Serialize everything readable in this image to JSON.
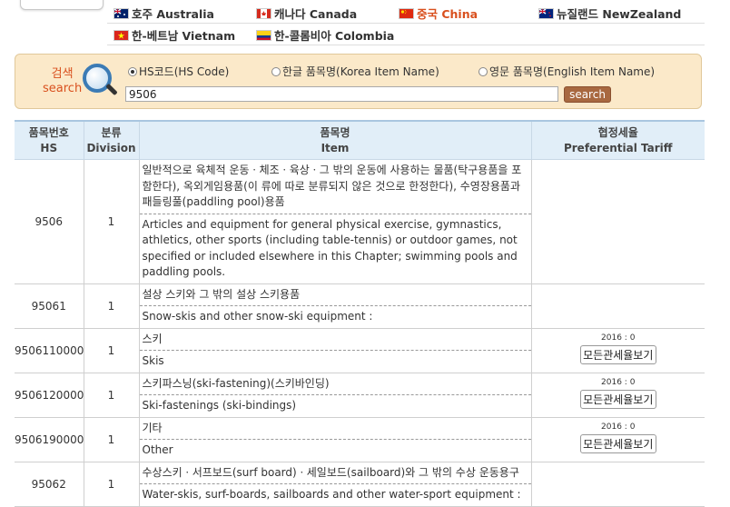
{
  "countries": {
    "row1": [
      {
        "label": "호주 Australia",
        "flag": "australia-flag-icon"
      },
      {
        "label": "캐나다 Canada",
        "flag": "canada-flag-icon"
      },
      {
        "label": "중국 China",
        "flag": "china-flag-icon",
        "active": true
      },
      {
        "label": "뉴질랜드 NewZealand",
        "flag": "newzealand-flag-icon"
      }
    ],
    "row2": [
      {
        "label": "한-베트남 Vietnam",
        "flag": "vietnam-flag-icon"
      },
      {
        "label": "한-콜롬비아 Colombia",
        "flag": "colombia-flag-icon"
      }
    ]
  },
  "search": {
    "title_ko": "검색",
    "title_en": "search",
    "options": [
      {
        "label": "HS코드(HS Code)",
        "selected": true
      },
      {
        "label": "한글 품목명(Korea Item Name)",
        "selected": false
      },
      {
        "label": "영문 품목명(English Item Name)",
        "selected": false
      }
    ],
    "value": "9506",
    "button": "search"
  },
  "table": {
    "headers": {
      "hs_ko": "품목번호",
      "hs_en": "HS",
      "div_ko": "분류",
      "div_en": "Division",
      "item_ko": "품목명",
      "item_en": "Item",
      "tariff_ko": "협정세율",
      "tariff_en": "Preferential Tariff"
    },
    "rows": [
      {
        "hs": "9506",
        "division": "1",
        "item_ko": "일반적으로 육체적 운동ㆍ체조ㆍ육상ㆍ그 밖의 운동에 사용하는 물품(탁구용품을 포함한다), 옥외게임용품(이 류에 따로 분류되지 않은 것으로 한정한다), 수영장용품과 패들링풀(paddling pool)용품",
        "item_en": "Articles and equipment for general physical exercise, gymnastics, athletics, other sports (including table-tennis) or outdoor games, not specified or included elsewhere in this Chapter; swimming pools and paddling pools."
      },
      {
        "hs": "95061",
        "division": "1",
        "item_ko": "설상 스키와 그 밖의 설상 스키용품",
        "item_en": "Snow-skis and other snow-ski equipment :"
      },
      {
        "hs": "9506110000",
        "division": "1",
        "item_ko": "스키",
        "item_en": "Skis",
        "tariff_year": "2016 : 0",
        "tariff_button": "모든관세율보기"
      },
      {
        "hs": "9506120000",
        "division": "1",
        "item_ko": "스키파스닝(ski-fastening)(스키바인딩)",
        "item_en": "Ski-fastenings (ski-bindings)",
        "tariff_year": "2016 : 0",
        "tariff_button": "모든관세율보기"
      },
      {
        "hs": "9506190000",
        "division": "1",
        "item_ko": "기타",
        "item_en": "Other",
        "tariff_year": "2016 : 0",
        "tariff_button": "모든관세율보기"
      },
      {
        "hs": "95062",
        "division": "1",
        "item_ko": "수상스키ㆍ서프보드(surf board)ㆍ세일보드(sailboard)와 그 밖의 수상 운동용구",
        "item_en": "Water-skis, surf-boards, sailboards and other water-sport equipment :"
      }
    ]
  }
}
